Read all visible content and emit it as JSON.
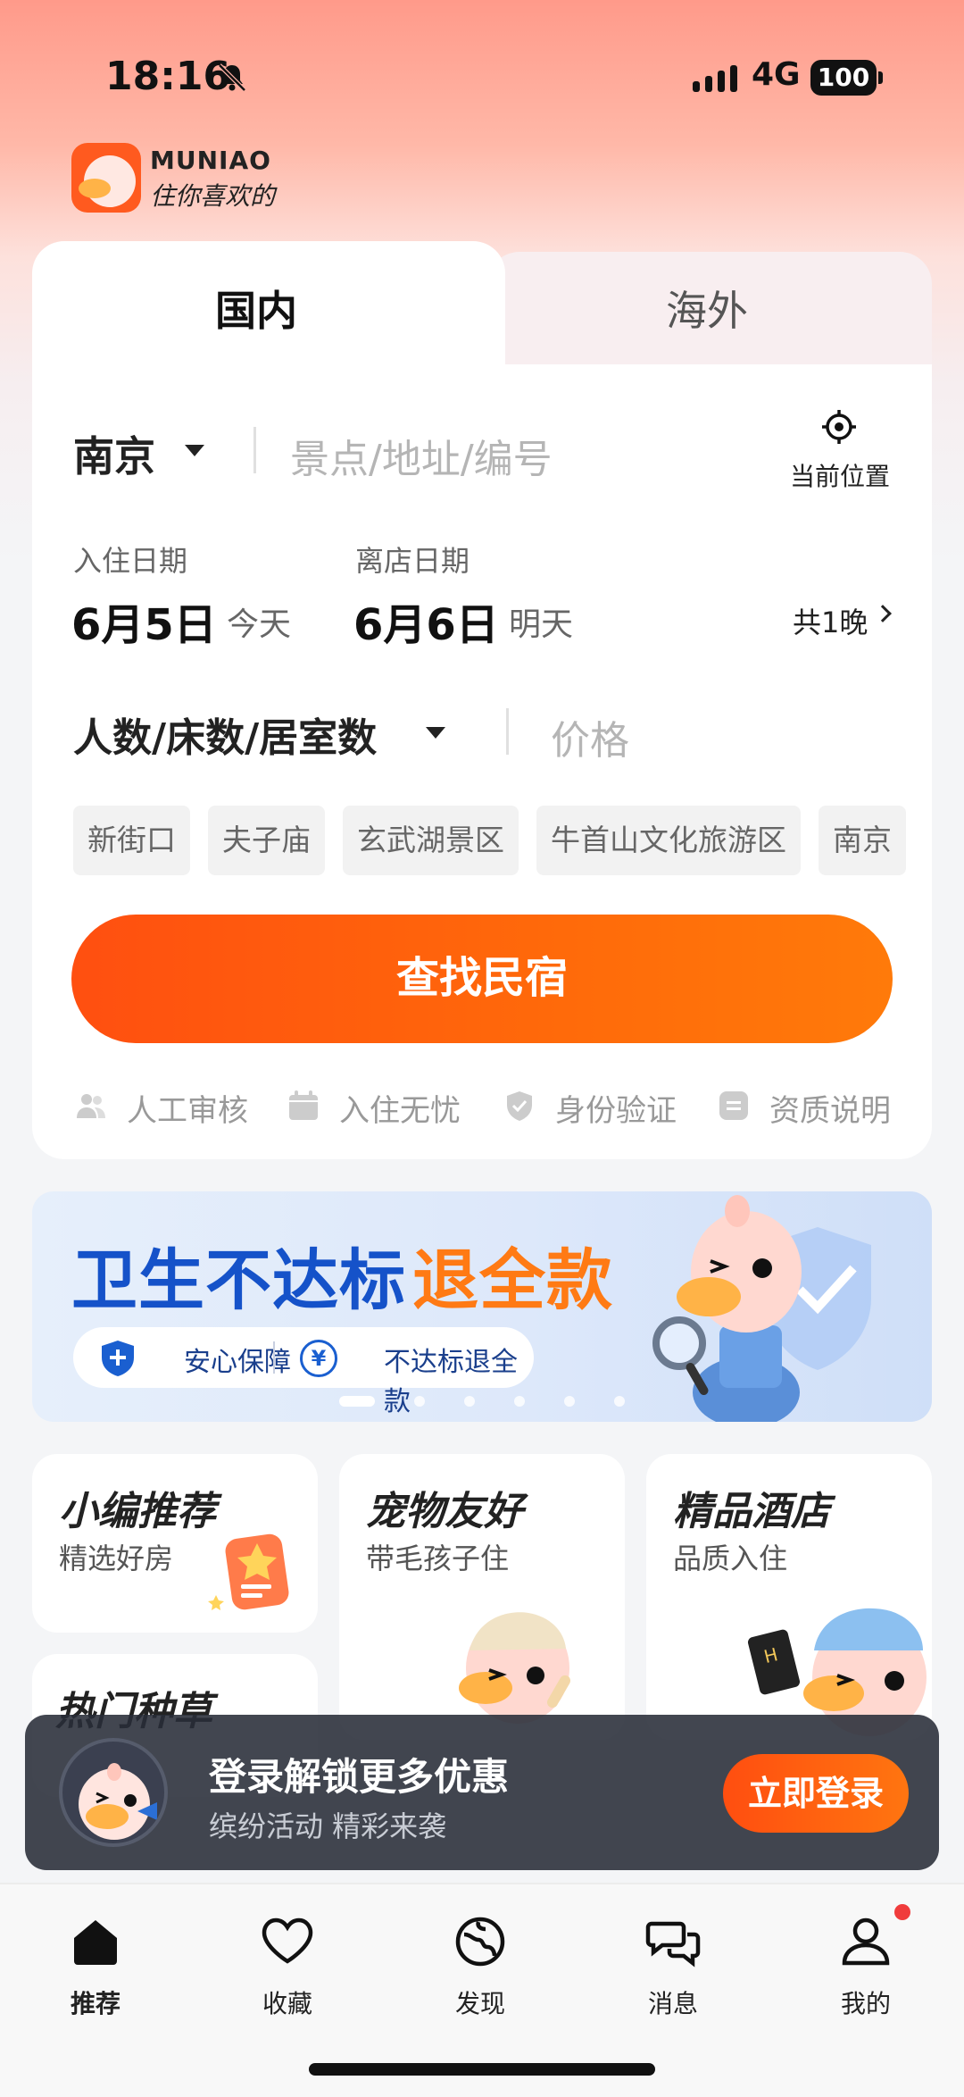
{
  "status_bar": {
    "time": "18:16",
    "network": "4G",
    "battery": "100"
  },
  "brand": {
    "name": "MUNIAO",
    "slogan": "住你喜欢的"
  },
  "search_tabs": [
    {
      "label": "国内",
      "active": true
    },
    {
      "label": "海外",
      "active": false
    }
  ],
  "search": {
    "city": "南京",
    "keyword_placeholder": "景点/地址/编号",
    "location_label": "当前位置"
  },
  "dates": {
    "checkin_label": "入住日期",
    "checkin_date": "6月5日",
    "checkin_day": "今天",
    "checkout_label": "离店日期",
    "checkout_date": "6月6日",
    "checkout_day": "明天",
    "nights": "共1晚"
  },
  "guests_label": "人数/床数/居室数",
  "price_placeholder": "价格",
  "quick_tags": [
    "新街口",
    "夫子庙",
    "玄武湖景区",
    "牛首山文化旅游区",
    "南京"
  ],
  "search_button": "查找民宿",
  "assurances": [
    "人工审核",
    "入住无忧",
    "身份验证",
    "资质说明"
  ],
  "banner": {
    "title_part1": "卫生不达标",
    "title_part2": "退全款",
    "tag1": "安心保障",
    "tag2": "不达标退全款",
    "yen_symbol": "¥",
    "slide_count": 6,
    "active_slide": 1
  },
  "categories": [
    {
      "title": "小编推荐",
      "subtitle": "精选好房"
    },
    {
      "title": "宠物友好",
      "subtitle": "带毛孩子住"
    },
    {
      "title": "精品酒店",
      "subtitle": "品质入住"
    },
    {
      "title": "热门种草",
      "subtitle": ""
    }
  ],
  "login_prompt": {
    "title": "登录解锁更多优惠",
    "subtitle": "缤纷活动 精彩来袭",
    "button": "立即登录"
  },
  "tabbar": [
    {
      "label": "推荐",
      "icon": "home-icon",
      "active": true
    },
    {
      "label": "收藏",
      "icon": "heart-icon",
      "active": false
    },
    {
      "label": "发现",
      "icon": "discover-icon",
      "active": false
    },
    {
      "label": "消息",
      "icon": "message-icon",
      "active": false
    },
    {
      "label": "我的",
      "icon": "profile-icon",
      "active": false,
      "badge": true
    }
  ],
  "colors": {
    "accent": "#ff5a14",
    "banner_blue": "#1552c9",
    "banner_orange": "#ff7a14",
    "badge_red": "#f03c3c"
  }
}
